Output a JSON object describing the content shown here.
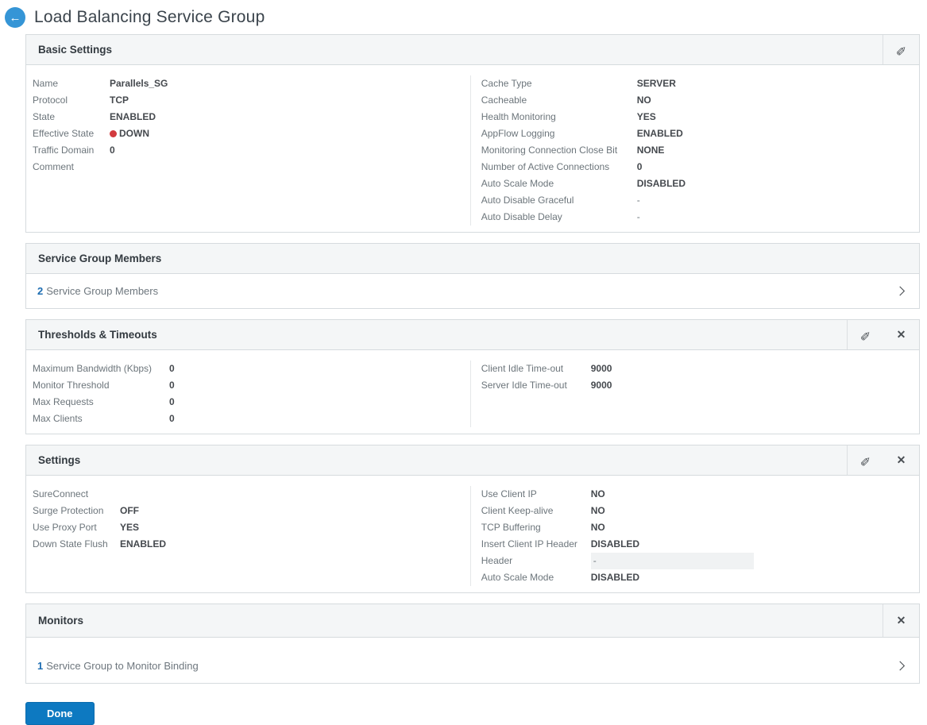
{
  "header": {
    "title": "Load Balancing Service Group"
  },
  "icons": {
    "back": "←",
    "edit": "✎",
    "close": "✕"
  },
  "colors": {
    "accent_blue": "#0d79c1",
    "link_blue": "#1d6db2",
    "status_down_red": "#d23a3e",
    "panel_header_bg": "#f4f6f7"
  },
  "basic_settings": {
    "title": "Basic Settings",
    "left": [
      {
        "label": "Name",
        "value": "Parallels_SG"
      },
      {
        "label": "Protocol",
        "value": "TCP"
      },
      {
        "label": "State",
        "value": "ENABLED"
      },
      {
        "label": "Effective State",
        "value": "DOWN",
        "dot": true
      },
      {
        "label": "Traffic Domain",
        "value": "0"
      },
      {
        "label": "Comment",
        "value": ""
      }
    ],
    "right": [
      {
        "label": "Cache Type",
        "value": "SERVER"
      },
      {
        "label": "Cacheable",
        "value": "NO"
      },
      {
        "label": "Health Monitoring",
        "value": "YES"
      },
      {
        "label": "AppFlow Logging",
        "value": "ENABLED"
      },
      {
        "label": "Monitoring Connection Close Bit",
        "value": "NONE"
      },
      {
        "label": "Number of Active Connections",
        "value": "0"
      },
      {
        "label": "Auto Scale Mode",
        "value": "DISABLED"
      },
      {
        "label": "Auto Disable Graceful",
        "value": "-",
        "muted": true
      },
      {
        "label": "Auto Disable Delay",
        "value": "-",
        "muted": true
      }
    ]
  },
  "service_group_members": {
    "title": "Service Group Members",
    "count": "2",
    "link_text": "Service Group Members"
  },
  "thresholds_timeouts": {
    "title": "Thresholds & Timeouts",
    "left": [
      {
        "label": "Maximum Bandwidth (Kbps)",
        "value": "0"
      },
      {
        "label": "Monitor Threshold",
        "value": "0"
      },
      {
        "label": "Max Requests",
        "value": "0"
      },
      {
        "label": "Max Clients",
        "value": "0"
      }
    ],
    "right": [
      {
        "label": "Client Idle Time-out",
        "value": "9000"
      },
      {
        "label": "Server Idle Time-out",
        "value": "9000"
      }
    ]
  },
  "settings": {
    "title": "Settings",
    "left": [
      {
        "label": "SureConnect",
        "value": ""
      },
      {
        "label": "Surge Protection",
        "value": "OFF"
      },
      {
        "label": "Use Proxy Port",
        "value": "YES"
      },
      {
        "label": "Down State Flush",
        "value": "ENABLED"
      }
    ],
    "right": [
      {
        "label": "Use Client IP",
        "value": "NO"
      },
      {
        "label": "Client Keep-alive",
        "value": "NO"
      },
      {
        "label": "TCP Buffering",
        "value": "NO"
      },
      {
        "label": "Insert Client IP Header",
        "value": "DISABLED"
      },
      {
        "label": "Header",
        "value": "-",
        "muted": true,
        "box": true
      },
      {
        "label": "Auto Scale Mode",
        "value": "DISABLED"
      }
    ]
  },
  "monitors": {
    "title": "Monitors",
    "count": "1",
    "link_text": "Service Group to Monitor Binding"
  },
  "footer": {
    "done_label": "Done"
  }
}
